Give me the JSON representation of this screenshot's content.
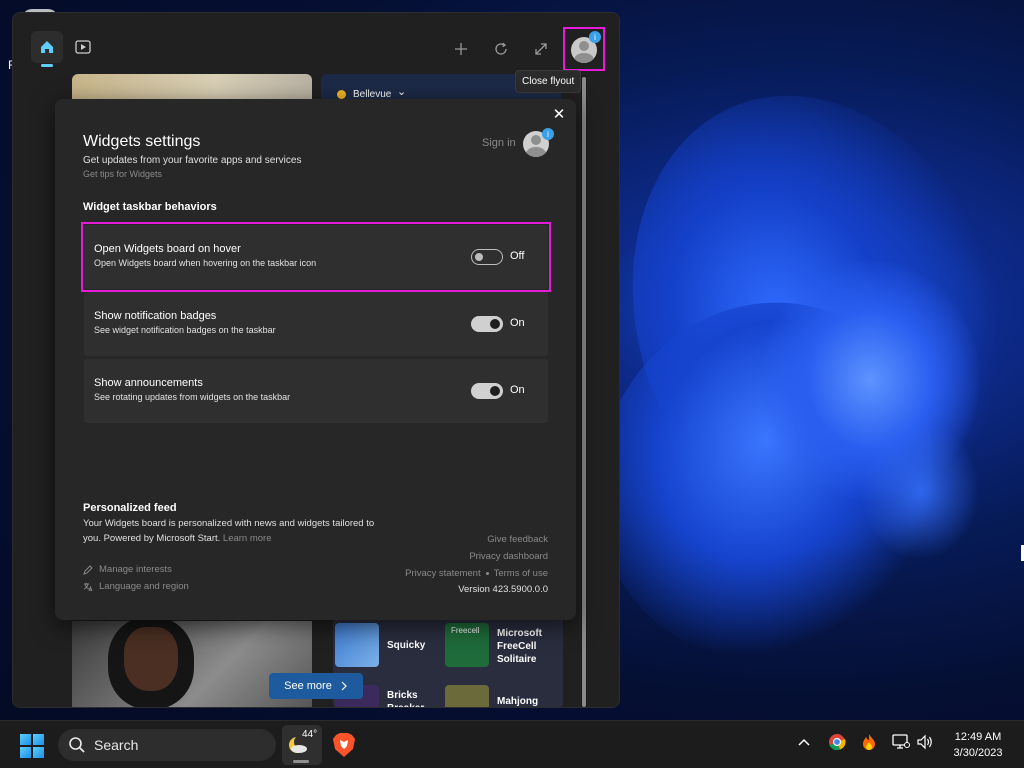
{
  "desktop": {
    "icon_label": "F"
  },
  "board": {
    "tooltip": "Close flyout",
    "weather_card": {
      "location": "Bellevue"
    },
    "games": [
      {
        "name": "Squicky"
      },
      {
        "name": "Microsoft FreeCell Solitaire",
        "tile_text": "Freecell"
      },
      {
        "name": "Bricks Breaker"
      },
      {
        "name": "Mahjong"
      }
    ],
    "see_more": "See more"
  },
  "settings": {
    "title": "Widgets settings",
    "subtitle": "Get updates from your favorite apps and services",
    "tips_link": "Get tips for Widgets",
    "sign_in": "Sign in",
    "section_title": "Widget taskbar behaviors",
    "rows": [
      {
        "title": "Open Widgets board on hover",
        "desc": "Open Widgets board when hovering on the taskbar icon",
        "state": "Off"
      },
      {
        "title": "Show notification badges",
        "desc": "See widget notification badges on the taskbar",
        "state": "On"
      },
      {
        "title": "Show announcements",
        "desc": "See rotating updates from widgets on the taskbar",
        "state": "On"
      }
    ],
    "feed_title": "Personalized feed",
    "feed_desc": "Your Widgets board is personalized with news and widgets tailored to you. Powered by Microsoft Start.",
    "learn_more": "Learn more",
    "manage_interests": "Manage interests",
    "language_region": "Language and region",
    "give_feedback": "Give feedback",
    "privacy_dashboard": "Privacy dashboard",
    "privacy_statement": "Privacy statement",
    "terms_of_use": "Terms of use",
    "version": "Version 423.5900.0.0"
  },
  "taskbar": {
    "search_label": "Search",
    "weather_temp": "44°",
    "time": "12:49 AM",
    "date": "3/30/2023"
  },
  "colors": {
    "highlight": "#e31cd8",
    "accent": "#60cdff",
    "panel": "#272727"
  }
}
